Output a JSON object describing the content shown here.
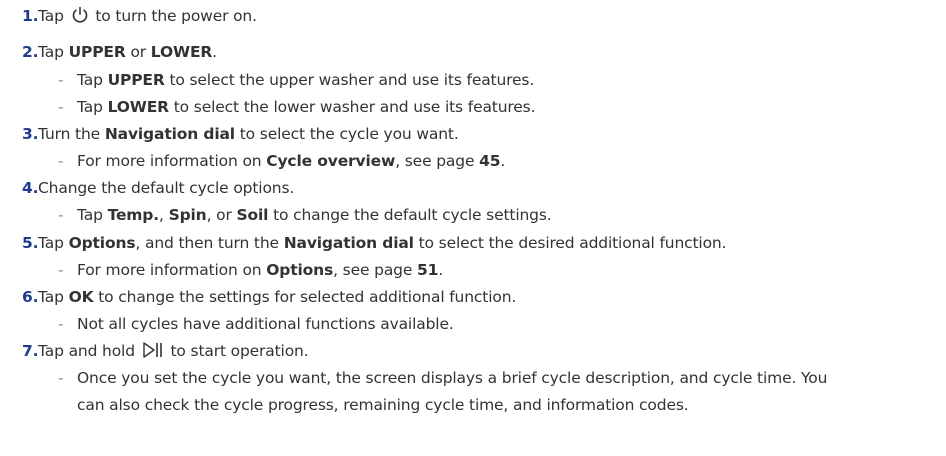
{
  "steps": [
    {
      "num": "1.",
      "parts": [
        "Tap",
        "to turn the power on."
      ],
      "icon": "power-icon"
    },
    {
      "num": "2.",
      "parts": [
        "Tap ",
        "UPPER",
        " or ",
        "LOWER",
        "."
      ],
      "subs": [
        [
          "Tap ",
          "UPPER",
          " to select the upper washer and use its features."
        ],
        [
          "Tap ",
          "LOWER",
          " to select the lower washer and use its features."
        ]
      ]
    },
    {
      "num": "3.",
      "parts": [
        "Turn the ",
        "Navigation dial",
        " to select the cycle you want."
      ],
      "subs": [
        [
          "For more information on ",
          "Cycle overview",
          ", see page ",
          "45",
          "."
        ]
      ]
    },
    {
      "num": "4.",
      "parts": [
        "Change the default cycle options."
      ],
      "subs": [
        [
          "Tap ",
          "Temp.",
          ", ",
          "Spin",
          ", or ",
          "Soil",
          " to change the default cycle settings."
        ]
      ]
    },
    {
      "num": "5.",
      "parts": [
        "Tap ",
        "Options",
        ", and then turn the ",
        "Navigation dial",
        " to select the desired additional function."
      ],
      "subs": [
        [
          "For more information on ",
          "Options",
          ", see page ",
          "51",
          "."
        ]
      ]
    },
    {
      "num": "6.",
      "parts": [
        "Tap ",
        "OK",
        " to change the settings for selected additional function."
      ],
      "subs": [
        [
          "Not all cycles have additional functions available."
        ]
      ]
    },
    {
      "num": "7.",
      "parts": [
        "Tap and hold",
        "to start operation."
      ],
      "icon": "start-pause-icon",
      "subs": [
        [
          "Once you set the cycle you want, the screen displays a brief cycle description, and cycle time. You"
        ]
      ],
      "sub_continuation": "can also check the cycle progress, remaining cycle time, and information codes."
    }
  ],
  "dash": "-",
  "colors": {
    "text": "#333333",
    "number": "#1f3d8c",
    "dash": "#888888"
  }
}
